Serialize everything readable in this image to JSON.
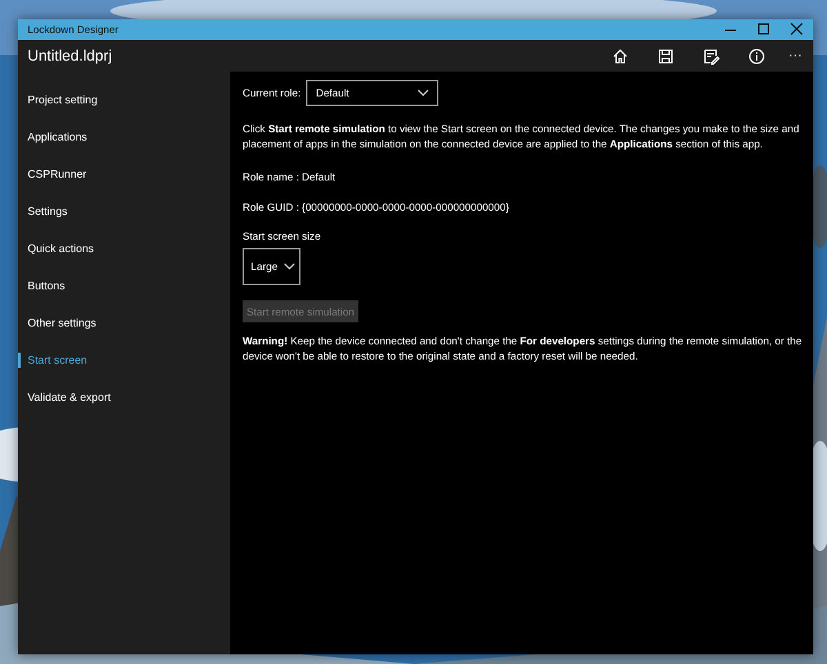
{
  "window": {
    "title": "Lockdown Designer"
  },
  "header": {
    "file_name": "Untitled.ldprj",
    "more": "···"
  },
  "sidebar": {
    "items": [
      {
        "label": "Project setting",
        "selected": false
      },
      {
        "label": "Applications",
        "selected": false
      },
      {
        "label": "CSPRunner",
        "selected": false
      },
      {
        "label": "Settings",
        "selected": false
      },
      {
        "label": "Quick actions",
        "selected": false
      },
      {
        "label": "Buttons",
        "selected": false
      },
      {
        "label": "Other settings",
        "selected": false
      },
      {
        "label": "Start screen",
        "selected": true
      },
      {
        "label": "Validate & export",
        "selected": false
      }
    ]
  },
  "content": {
    "role_label": "Current role:",
    "role_value": "Default",
    "description": "Click **Start remote simulation** to view the Start screen on the connected device.  The changes you make to the size and placement of apps in the simulation on the connected device are applied to the **Applications** section of this app.",
    "role_name": "Role name : Default",
    "role_guid": "Role GUID : {00000000-0000-0000-0000-000000000000}",
    "size_label": "Start screen size",
    "size_value": "Large",
    "start_button": {
      "label": "Start remote simulation",
      "disabled": true
    },
    "warning": "**Warning!** Keep the device connected and don't change the **For developers** settings during the remote simulation, or the device won't be able to restore to the original state and a factory reset will be needed."
  }
}
